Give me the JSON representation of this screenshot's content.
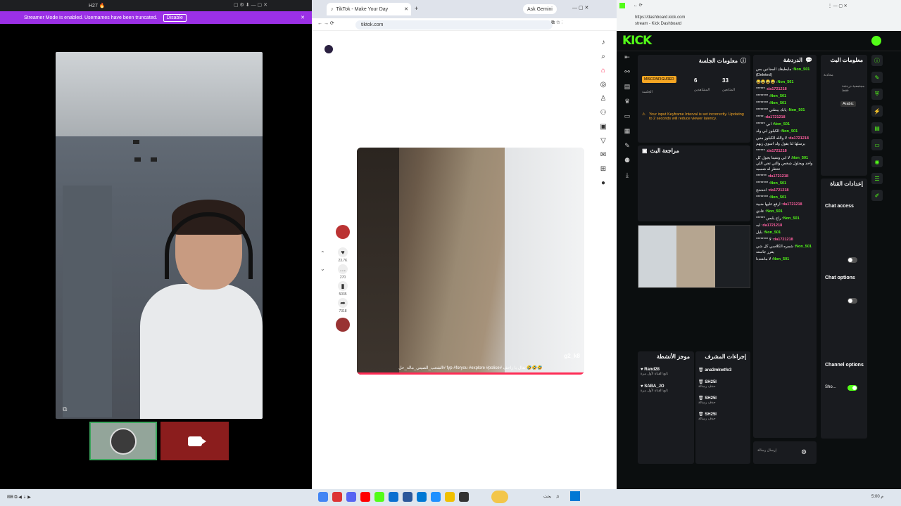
{
  "left": {
    "title": "H27 🔥",
    "banner": {
      "text": "Streamer Mode is enabled. Usernames have been truncated.",
      "button": "Disable"
    }
  },
  "browser": {
    "tab_title": "TikTok - Make Your Day",
    "ask_gemini": "Ask Gemini",
    "url": "tiktok.com",
    "video": {
      "username": "g2_k8",
      "caption": "🤣🤣🤣 تعال يا زاحف #fyp #foryou #explore #police #الشعب_الصيني_ماله_حل"
    },
    "actions": {
      "likes": "23.7K",
      "comments": "270",
      "saves": "5035",
      "shares": "7318"
    }
  },
  "kick": {
    "url": "https://dashboard.kick.com",
    "url_sub": "stream - Kick Dashboard",
    "logo": "KICK",
    "session": {
      "title": "معلومات الجلسة",
      "status": "MISCONFIGURED",
      "status_label": "الجلسة",
      "viewers": "6",
      "viewers_label": "المشاهدين",
      "followers": "33",
      "followers_label": "المتابعين",
      "warning": "Your input Keyframe Interval is set incorrectly. Updating to 2 seconds will reduce viewer latency.",
      "review": "مراجعة البث"
    },
    "chat": {
      "title": "الدردشة",
      "messages": [
        {
          "user": "Non_501",
          "text": "مايطيقك المجانين بس (Deleted)",
          "cls": "u1"
        },
        {
          "user": "Non_501",
          "text": "😂😂😂😂",
          "cls": "u1"
        },
        {
          "user": "da1721218",
          "text": "******",
          "cls": "u2"
        },
        {
          "user": "Non_501",
          "text": "********",
          "cls": "u1"
        },
        {
          "user": "Non_501",
          "text": "********",
          "cls": "u1"
        },
        {
          "user": "Non_501",
          "text": "يابك يبطني ********",
          "cls": "u1"
        },
        {
          "user": "da1721218",
          "text": "*****",
          "cls": "u2"
        },
        {
          "user": "Non_501",
          "text": "ابي ******",
          "cls": "u1"
        },
        {
          "user": "Non_501",
          "text": "الكبلوز ابي ولد",
          "cls": "u1"
        },
        {
          "user": "da1721218",
          "text": "لا والله الكبلوز منين يرسلها لنا يقول ولد اسوي زيهم",
          "cls": "u2"
        },
        {
          "user": "da1721218",
          "text": "******",
          "cls": "u2"
        },
        {
          "user": "Non_501",
          "text": "لا ابي ونتنيتا يجول كل واحد ويحاول شخص والتي تجي اللي تنتظر له شسبه",
          "cls": "u1"
        },
        {
          "user": "da1721218",
          "text": "*******",
          "cls": "u2"
        },
        {
          "user": "Non_501",
          "text": "********",
          "cls": "u1"
        },
        {
          "user": "da1721218",
          "text": "احححح",
          "cls": "u2"
        },
        {
          "user": "Non_501",
          "text": "********",
          "cls": "u1"
        },
        {
          "user": "da1721218",
          "text": "ارفع عليها ضبية",
          "cls": "u2"
        },
        {
          "user": "Non_501",
          "text": "عادي",
          "cls": "u1"
        },
        {
          "user": "Non_501",
          "text": "راح يلبس ******",
          "cls": "u1"
        },
        {
          "user": "da1721218",
          "text": "لبه",
          "cls": "u2"
        },
        {
          "user": "Non_501",
          "text": "بليل",
          "cls": "u1"
        },
        {
          "user": "da1721218",
          "text": "لا ********",
          "cls": "u2"
        },
        {
          "user": "Non_501",
          "text": "شمره الكلاسي كل شي يقرر جاسته",
          "cls": "u1"
        },
        {
          "user": "Non_501",
          "text": "لا مانعندنا",
          "cls": "u1"
        }
      ]
    },
    "stream_info": {
      "title": "معلومات البث",
      "category": "محادثة",
      "category2": "مجتمعية دردشة فقط",
      "lang": "Arabic"
    },
    "channel_settings": {
      "title": "إعدادات القناة",
      "chat_access": "Chat access",
      "chat_options": "Chat options",
      "channel_options": "Channel options",
      "show": "Sho..."
    },
    "mod_actions": {
      "title": "إجراءات المشرف"
    },
    "recent_events": {
      "title": "موجز الأنشطة"
    },
    "events": [
      {
        "user": "Rand28",
        "text": "تابع القناة لأول مرة"
      },
      {
        "user": "SABA_JO",
        "text": "تابع القناة لأول مرة"
      }
    ],
    "mod_items": [
      {
        "user": "ana3mkwtfo3",
        "text": ""
      },
      {
        "user": "SH25I",
        "text": "حذف رسالة"
      },
      {
        "user": "SH25I",
        "text": "حذف رسالة"
      },
      {
        "user": "SH25I",
        "text": "حذف رسالة"
      }
    ],
    "send_placeholder": "إرسال رسالة"
  },
  "taskbar": {
    "time": "5:00 م",
    "search": "بحث"
  }
}
